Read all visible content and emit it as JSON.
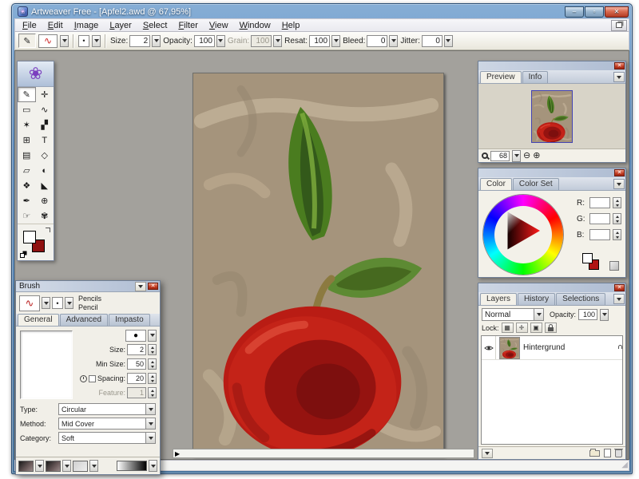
{
  "window": {
    "title": "Artweaver Free - [Apfel2.awd @ 67,95%]",
    "icon_glyph": "❀",
    "minimize_glyph": "–",
    "maximize_glyph": "▫",
    "close_glyph": "✕",
    "grip_glyph": "◢"
  },
  "menu": {
    "items": [
      "File",
      "Edit",
      "Image",
      "Layer",
      "Select",
      "Filter",
      "View",
      "Window",
      "Help"
    ]
  },
  "toolbar": {
    "current_tool_glyph": "✎",
    "brush_preview_glyph": "∿",
    "dot_glyph": "•",
    "fields": [
      {
        "label": "Size:",
        "value": "2"
      },
      {
        "label": "Opacity:",
        "value": "100"
      },
      {
        "label": "Grain:",
        "value": "100"
      },
      {
        "label": "Resat:",
        "value": "100"
      },
      {
        "label": "Bleed:",
        "value": "0"
      },
      {
        "label": "Jitter:",
        "value": "0"
      }
    ]
  },
  "toolbox": {
    "logo_glyph": "❀",
    "tools": [
      {
        "name": "brush",
        "glyph": "✎"
      },
      {
        "name": "move",
        "glyph": "✛"
      },
      {
        "name": "rect-select",
        "glyph": "▭"
      },
      {
        "name": "lasso",
        "glyph": "∿"
      },
      {
        "name": "magic-wand",
        "glyph": "✶"
      },
      {
        "name": "crop",
        "glyph": "▞"
      },
      {
        "name": "table",
        "glyph": "⊞"
      },
      {
        "name": "text",
        "glyph": "T"
      },
      {
        "name": "gradient",
        "glyph": "▤"
      },
      {
        "name": "shape",
        "glyph": "◇"
      },
      {
        "name": "eraser",
        "glyph": "▱"
      },
      {
        "name": "clone-stamp",
        "glyph": "◐"
      },
      {
        "name": "smudge",
        "glyph": "❖"
      },
      {
        "name": "fill",
        "glyph": "◣"
      },
      {
        "name": "eyedropper",
        "glyph": "✒"
      },
      {
        "name": "zoom",
        "glyph": "⊕"
      },
      {
        "name": "hand",
        "glyph": "☞"
      },
      {
        "name": "airbrush",
        "glyph": "✾"
      }
    ]
  },
  "scrollbar": {
    "left_arrow_glyph": "▶"
  },
  "preview_panel": {
    "tabs": [
      "Preview",
      "Info"
    ],
    "zoom_value": "68",
    "zoom_out_glyph": "⊖",
    "zoom_in_glyph": "⊕",
    "close_glyph": "✕"
  },
  "color_panel": {
    "tabs": [
      "Color",
      "Color Set"
    ],
    "channels": [
      {
        "label": "R:",
        "value": ""
      },
      {
        "label": "G:",
        "value": ""
      },
      {
        "label": "B:",
        "value": ""
      }
    ],
    "close_glyph": "✕"
  },
  "layers_panel": {
    "tabs": [
      "Layers",
      "History",
      "Selections"
    ],
    "blend_mode": "Normal",
    "opacity_label": "Opacity:",
    "opacity_value": "100",
    "lock_label": "Lock:",
    "lock_glyphs": [
      "▦",
      "✛",
      "▣"
    ],
    "layers": [
      {
        "name": "Hintergrund"
      }
    ],
    "close_glyph": "✕"
  },
  "brush_panel": {
    "title": "Brush",
    "group": "Pencils",
    "preset": "Pencil",
    "tabs": [
      "General",
      "Advanced",
      "Impasto"
    ],
    "stroke_glyph": "∿",
    "dot_glyph": "•",
    "tip_glyph": "●",
    "fields": [
      {
        "label": "Size:",
        "value": "2"
      },
      {
        "label": "Min Size:",
        "value": "50"
      },
      {
        "label": "Spacing:",
        "value": "20"
      },
      {
        "label": "Feature:",
        "value": "1"
      }
    ],
    "selects": [
      {
        "label": "Type:",
        "value": "Circular"
      },
      {
        "label": "Method:",
        "value": "Mid Cover"
      },
      {
        "label": "Category:",
        "value": "Soft"
      }
    ],
    "close_glyph": "✕"
  },
  "colors": {
    "titlebar_blue": "#5b88b8",
    "panel_bg": "#f3f1e9",
    "close_red": "#c23b22",
    "canvas_tan": "#a5947c",
    "apple_red": "#c42318",
    "leaf_green": "#4a7c1f"
  }
}
